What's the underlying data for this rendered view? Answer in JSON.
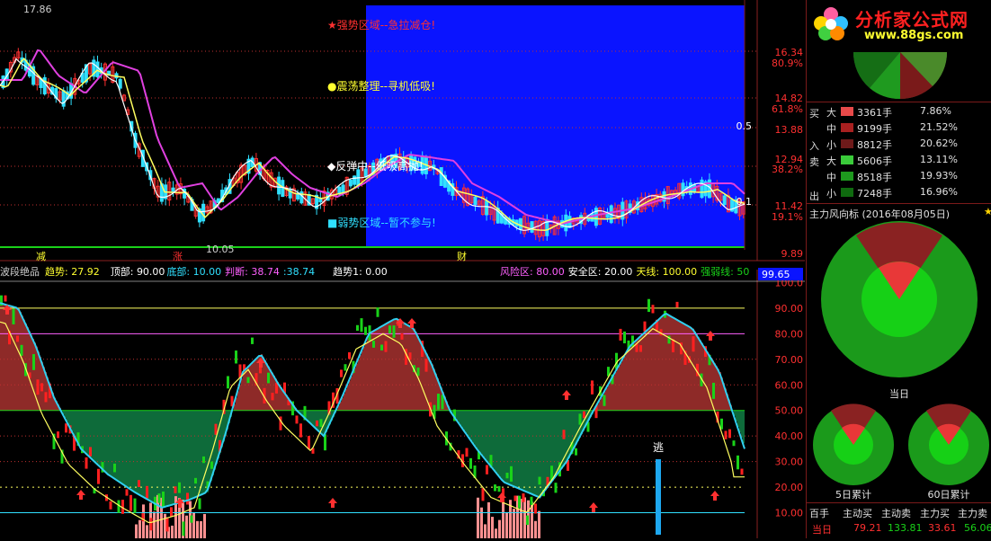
{
  "upper": {
    "price_high": "17.86",
    "price_low": "10.05",
    "price_axis": [
      "16.34",
      "14.82",
      "13.88",
      "12.94",
      "11.42",
      "9.89"
    ],
    "pct_axis": [
      "80.9%",
      "61.8%",
      "38.2%",
      "19.1%"
    ],
    "level_labels": [
      "0.5",
      "0.1"
    ],
    "zone_strong": "★强势区域--急拉减仓!",
    "zone_consolidate": "●震荡整理--寻机低吸!",
    "zone_rebound": "◆反弹中--低吸高抛!",
    "zone_weak": "■弱势区域--暂不参与!",
    "bottom_labels": [
      "减",
      "涨",
      "财"
    ]
  },
  "indicator_header": {
    "name": "波段绝品",
    "trend_label": "趋势:",
    "trend_value": "27.92",
    "top_label": "顶部:",
    "top_value": "90.00",
    "bottom_label": "底部:",
    "bottom_value": "10.00",
    "judge_label": "判断:",
    "judge_value": "38.74",
    "judge2": ":38.74",
    "trend1_label": "趋势1:",
    "trend1_value": "0.00",
    "risk_label": "风险区:",
    "risk_value": "80.00",
    "safe_label": "安全区:",
    "safe_value": "20.00",
    "sky_label": "天线:",
    "sky_value": "100.00",
    "strong_label": "强弱线:",
    "strong_value": "50",
    "cursor_value": "99.65"
  },
  "lower": {
    "axis": [
      "100.0",
      "90.00",
      "80.00",
      "70.00",
      "60.00",
      "50.00",
      "40.00",
      "30.00",
      "20.00",
      "10.00"
    ],
    "escape_label": "逃"
  },
  "panel": {
    "logo_text": "分析家公式网",
    "logo_url": "www.88gs.com",
    "buy_label_1": "买",
    "buy_label_2": "入",
    "sell_label_1": "卖",
    "sell_label_2": "出",
    "rows": [
      {
        "size": "大",
        "vol": "3361手",
        "pct": "7.86%",
        "color": "#e84a4a"
      },
      {
        "size": "中",
        "vol": "9199手",
        "pct": "21.52%",
        "color": "#a82020"
      },
      {
        "size": "小",
        "vol": "8812手",
        "pct": "20.62%",
        "color": "#6e1a1a"
      },
      {
        "size": "大",
        "vol": "5606手",
        "pct": "13.11%",
        "color": "#3acb3a"
      },
      {
        "size": "中",
        "vol": "8518手",
        "pct": "19.93%",
        "color": "#1e9a1e"
      },
      {
        "size": "小",
        "vol": "7248手",
        "pct": "16.96%",
        "color": "#0f6a0f"
      }
    ],
    "direction_title": "主力风向标 (2016年08月05日)",
    "today_label": "当日",
    "day5_label": "5日累计",
    "day60_label": "60日累计",
    "flow_headers": [
      "百手",
      "主动买",
      "主动卖",
      "主力买",
      "主力卖"
    ],
    "flow_row": [
      "当日",
      "79.21",
      "133.81",
      "33.61",
      "56.06"
    ]
  },
  "colors": {
    "blue_zone": "#0a14ff",
    "red_line": "#ff3030",
    "green": "#19d219",
    "dark_red": "#8e2a28",
    "dark_green": "#0e6b3a"
  }
}
